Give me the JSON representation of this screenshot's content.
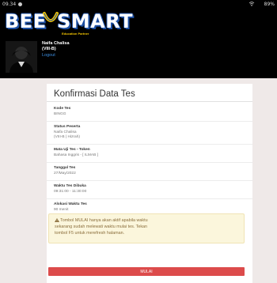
{
  "status_bar": {
    "time": "09.34",
    "battery": "89%"
  },
  "header": {
    "logo_left": "BEE",
    "logo_right": "SMART",
    "logo_tagline": "Education Partner",
    "user_name": "Naifa Chalisa",
    "user_class": "(VIII-B)",
    "logout_label": "Logout"
  },
  "card": {
    "title": "Konfirmasi Data Tes",
    "fields": [
      {
        "label": "Kode Tes",
        "value": "BINGG"
      },
      {
        "label": "Status Peserta",
        "value": "Naifa Chalisa",
        "value2": "(VIII-B | Hizrah)"
      },
      {
        "label": "Mata Uji Tes - Token",
        "value": "Bahasa Inggris - [ ILMAB ]"
      },
      {
        "label": "Tanggal Tes",
        "value": "27/May/2022"
      },
      {
        "label": "Waktu Tes Dibuka",
        "value": "09:31:00 - 11:30:00"
      },
      {
        "label": "Alokasi Waktu Tes",
        "value": "90 menit"
      }
    ],
    "warning": {
      "line1": "Tombol MULAI hanya akan aktif apabila waktu",
      "line2": "sekarang sudah melewati waktu mulai tes. Tekan",
      "line3": "tombol F5 untuk merefresh halaman."
    },
    "start_button": "MULAI"
  },
  "colors": {
    "header_bg": "#000000",
    "logo_blue": "#1c4fa3",
    "logo_yellow": "#f4c500",
    "button_red": "#dc4b4b",
    "warning_bg": "#fbf6dc"
  }
}
